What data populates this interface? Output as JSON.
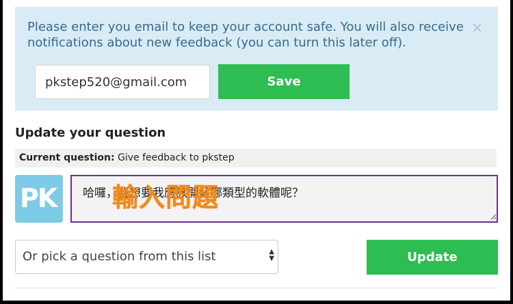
{
  "notice": {
    "message": "Please enter you email to keep your account safe. You will also receive notifications about new feedback (you can turn this later off).",
    "close_symbol": "×",
    "email_value": "pkstep520@gmail.com",
    "save_label": "Save"
  },
  "update": {
    "title": "Update your question",
    "current_label": "Current question:",
    "current_value": "Give feedback to pkstep",
    "avatar_initials": "PK",
    "question_value": "哈囉，我想要我應該開發哪類型的軟體呢？",
    "overlay_text": "輸入問題",
    "select_value": "Or pick a question from this list",
    "update_label": "Update"
  },
  "colors": {
    "notice_bg": "#d9ebf5",
    "button_green": "#2dbd52",
    "focus_purple": "#6a2d96",
    "overlay_orange": "#f28a16"
  }
}
